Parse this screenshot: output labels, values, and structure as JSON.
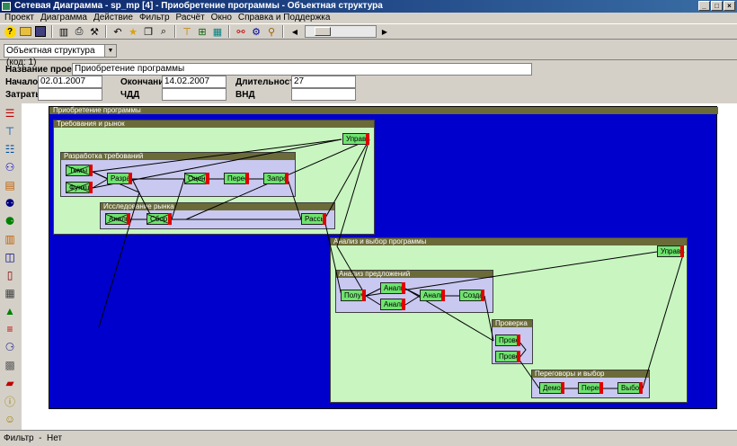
{
  "window": {
    "title": "Сетевая Диаграмма - sp_mp [4] - Приобретение программы - Объектная структура"
  },
  "menu": [
    "Проект",
    "Диаграмма",
    "Действие",
    "Фильтр",
    "Расчёт",
    "Окно",
    "Справка и Поддержка"
  ],
  "view_select": {
    "value": "Объектная структура (код: 1)"
  },
  "project": {
    "name_label": "Название проекта",
    "name_value": "Приобретение программы",
    "start_label": "Начало",
    "start_value": "02.01.2007",
    "end_label": "Окончание",
    "end_value": "14.02.2007",
    "duration_label": "Длительность",
    "duration_value": "27",
    "cost_label": "Затраты",
    "cost_value": "",
    "npv_label": "ЧДД",
    "npv_value": "",
    "irr_label": "ВНД",
    "irr_value": ""
  },
  "diagram": {
    "root_title": "Приобретение программы",
    "groups": {
      "g1": "Требования и рынок",
      "g1a": "Разработка требований",
      "g1b": "Исследование рынка",
      "g2": "Анализ и выбор программы",
      "g2a": "Анализ предложений",
      "g2b": "Проверка",
      "g2c": "Переговоры и выбор"
    },
    "nodes": {
      "n_uprav1": "Управ",
      "n_temy": "Темы",
      "n_funkts": "Функц",
      "n_razra": "Разра",
      "n_otsen": "Оцен",
      "n_peres": "Перес",
      "n_zapro": "Запро",
      "n_anali_r": "Анали",
      "n_sobor": "Сбор",
      "n_rass": "Рассы",
      "n_uprav2": "Управ",
      "n_poluch": "Получ",
      "n_anali1": "Анали",
      "n_anali2": "Анали",
      "n_anali3": "Анали",
      "n_sozda": "Созда",
      "n_prove1": "Прове",
      "n_prove2": "Прове",
      "n_demo": "Демо",
      "n_pereg": "Перег",
      "n_vybor": "Выбор"
    }
  },
  "status": {
    "text": "Фильтр  -  Нет"
  },
  "colors": {
    "canvas": "#0000cc",
    "group_green": "#c8f5c0",
    "group_violet": "#c8c8f0",
    "node_green": "#6fe36f",
    "node_marker": "#e00000",
    "titlebar": "#0a246a"
  }
}
